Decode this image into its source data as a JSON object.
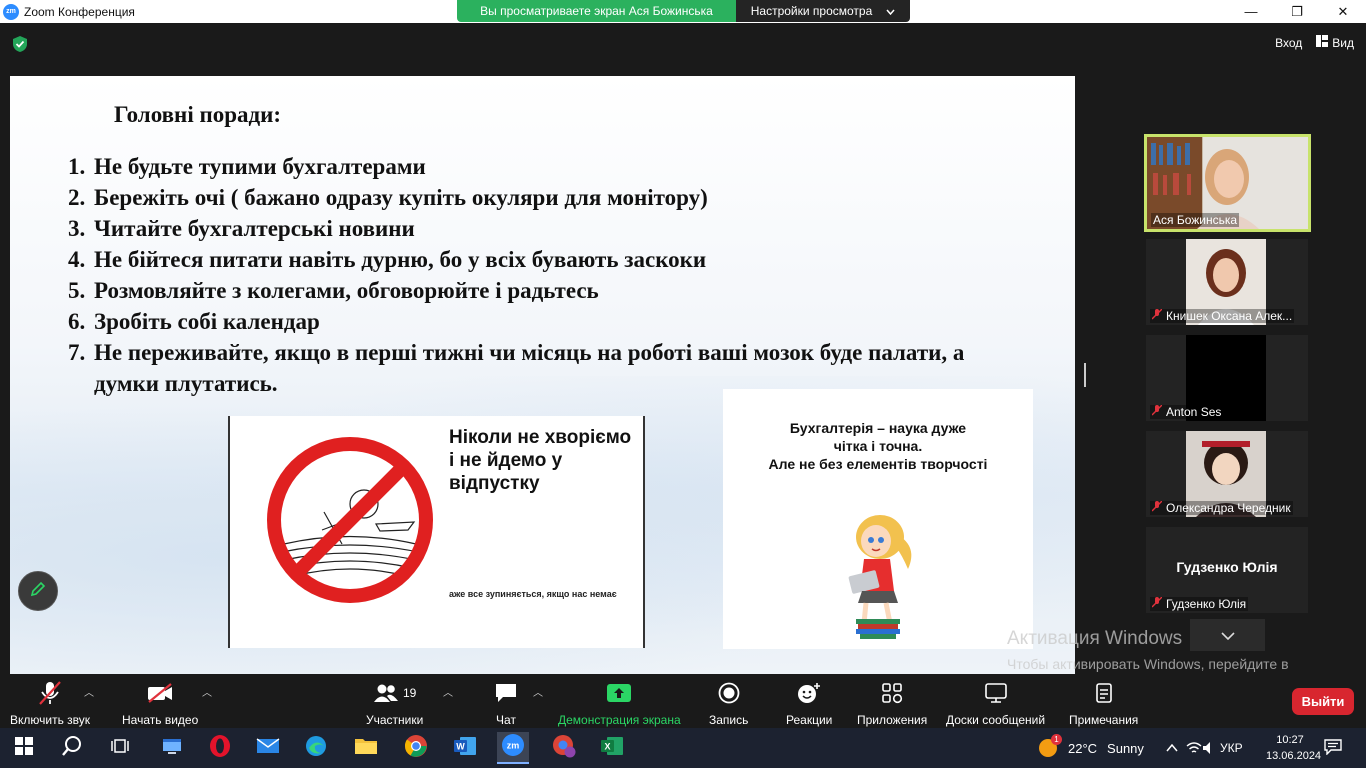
{
  "window": {
    "app_icon_text": "zm",
    "title": "Zoom Конференция",
    "share_banner": "Вы просматриваете экран Ася Божинська",
    "view_settings": "Настройки просмотра",
    "controls": [
      "—",
      "❐",
      "✕"
    ]
  },
  "header": {
    "enter_label": "Вход",
    "view_label": "Вид"
  },
  "slide": {
    "heading": "Головні поради:",
    "tips": [
      {
        "num": "1.",
        "text": "Не будьте тупими бухгалтерами"
      },
      {
        "num": "2.",
        "text": "Бережіть очі ( бажано одразу купіть окуляри для монітору)"
      },
      {
        "num": "3.",
        "text": "Читайте бухгалтерські новини"
      },
      {
        "num": "4.",
        "text": "Не бійтеся питати навіть дурню, бо у всіх бувають заскоки"
      },
      {
        "num": "5.",
        "text": "Розмовляйте з колегами, обговорюйте і радьтесь"
      },
      {
        "num": "6.",
        "text": "Зробіть собі календар"
      },
      {
        "num": "7.",
        "text": "Не переживайте, якщо в перші тижні чи місяць на роботі ваші мозок буде палати, а думки плутатись."
      }
    ],
    "image1": {
      "big_text": "Ніколи не хворіємо і не йдемо у відпустку",
      "small_text": "аже все зупиняється, якщо нас немає"
    },
    "image2": {
      "line1": "Бухгалтерія – наука дуже",
      "line2": "чітка і точна.",
      "line3": "Але не без елементів творчості"
    }
  },
  "participants": [
    {
      "name": "Ася Божинська",
      "muted": false,
      "active": true
    },
    {
      "name": "Книшек Оксана Алек...",
      "muted": true
    },
    {
      "name": "Anton Ses",
      "muted": true
    },
    {
      "name": "Олександра Чередник",
      "muted": true
    },
    {
      "name": "Гудзенко Юлія",
      "muted": true,
      "big_name": "Гудзенко Юлія"
    }
  ],
  "watermark": {
    "title": "Активация Windows",
    "text": "Чтобы активировать Windows, перейдите в раздел \"Параметры\"."
  },
  "toolbar": {
    "unmute": "Включить звук",
    "start_video": "Начать видео",
    "participants": "Участники",
    "participants_count": "19",
    "chat": "Чат",
    "share": "Демонстрация экрана",
    "record": "Запись",
    "reactions": "Реакции",
    "apps": "Приложения",
    "whiteboards": "Доски сообщений",
    "notes": "Примечания",
    "leave": "Выйти"
  },
  "taskbar": {
    "weather_temp": "22°C",
    "weather_desc": "Sunny",
    "weather_badge": "1",
    "language": "УКР",
    "time": "10:27",
    "date": "13.06.2024"
  },
  "colors": {
    "share_green": "#2bb15e",
    "active_speaker_border": "#c8e36b",
    "leave_red": "#d8262f",
    "muted_red": "#e0323c"
  }
}
